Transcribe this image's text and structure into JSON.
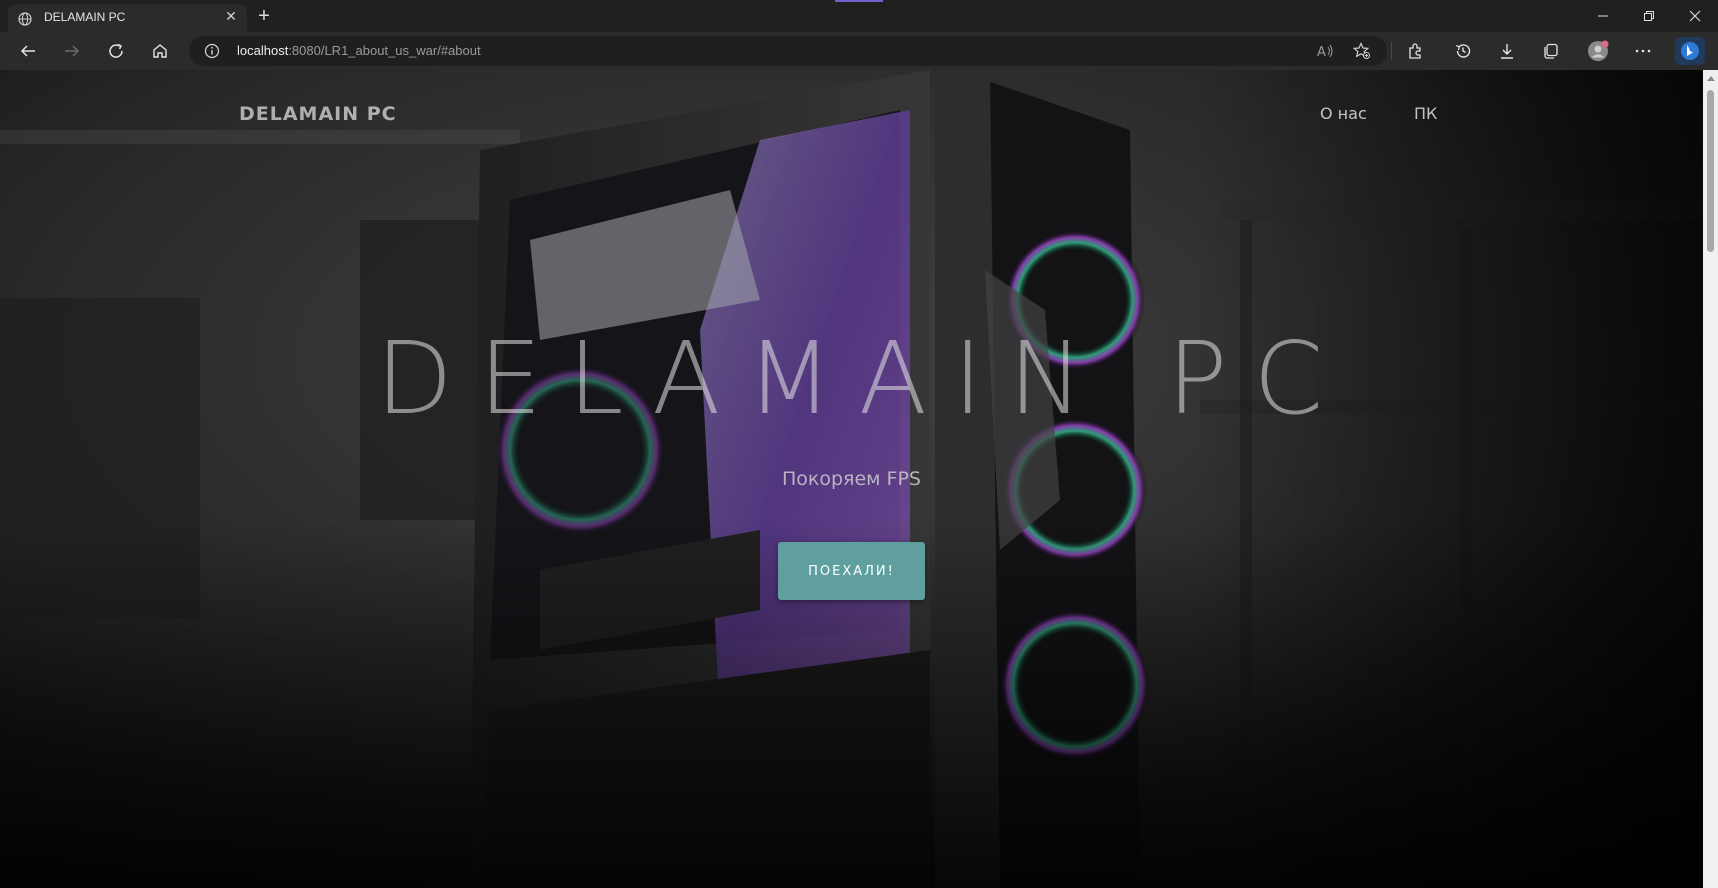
{
  "browser": {
    "tab_title": "DELAMAIN PC",
    "url_host": "localhost",
    "url_rest": ":8080/LR1_about_us_war/#about",
    "icons": [
      "globe-icon",
      "close-icon",
      "plus-icon",
      "back-icon",
      "forward-icon",
      "refresh-icon",
      "home-icon",
      "info-icon",
      "read-aloud-icon",
      "favorites-icon",
      "extensions-icon",
      "history-icon",
      "downloads-icon",
      "collections-icon",
      "profile-icon",
      "more-icon",
      "bing-icon",
      "minimize-icon",
      "maximize-icon",
      "window-close-icon"
    ]
  },
  "page": {
    "brand": "DELAMAIN PC",
    "nav": {
      "about": "О нас",
      "pc": "ПК"
    },
    "hero": {
      "title": "DELAMAIN PC",
      "subtitle": "Покоряем FPS",
      "button": "ПОЕХАЛИ!"
    }
  },
  "colors": {
    "button_bg": "#5f9f9f",
    "chrome_bg": "#202020",
    "toolbar_bg": "#2b2b2b"
  }
}
